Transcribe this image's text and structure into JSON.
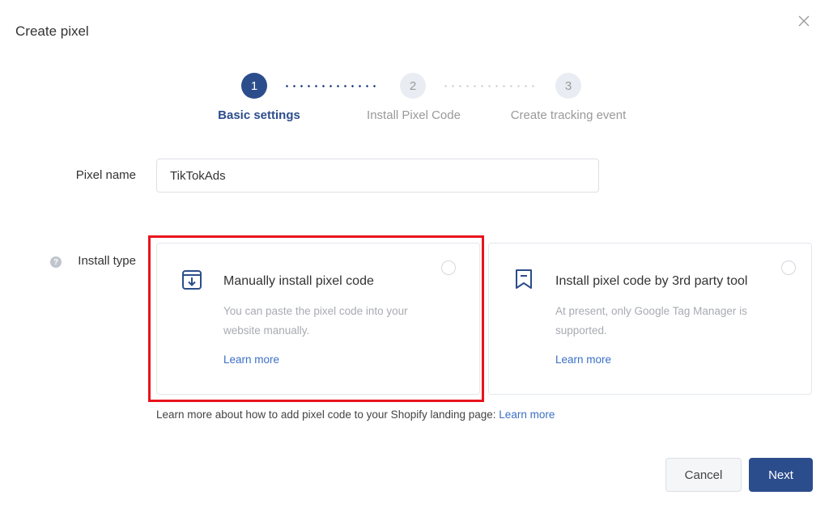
{
  "dialog": {
    "title": "Create pixel",
    "close_icon": "close-icon"
  },
  "stepper": {
    "steps": [
      {
        "number": "1",
        "label": "Basic settings",
        "state": "active"
      },
      {
        "number": "2",
        "label": "Install Pixel Code",
        "state": "inactive"
      },
      {
        "number": "3",
        "label": "Create tracking event",
        "state": "inactive"
      }
    ],
    "colors": {
      "active": "#2c4d8c",
      "inactive": "#e9ecf2"
    }
  },
  "form": {
    "pixel_name": {
      "label": "Pixel name",
      "value": "TikTokAds"
    },
    "install_type": {
      "label": "Install type",
      "help_icon": "question-circle-icon",
      "options": [
        {
          "icon": "download-box-icon",
          "title": "Manually install pixel code",
          "description": "You can paste the pixel code into your website manually.",
          "link": "Learn more",
          "selected": false,
          "highlighted": true
        },
        {
          "icon": "bookmark-icon",
          "title": "Install pixel code by 3rd party tool",
          "description": "At present, only Google Tag Manager is supported.",
          "link": "Learn more",
          "selected": false,
          "highlighted": false
        }
      ]
    },
    "hint": {
      "text": "Learn more about how to add pixel code to your Shopify landing page: ",
      "link": "Learn more"
    }
  },
  "footer": {
    "cancel_label": "Cancel",
    "next_label": "Next"
  },
  "colors": {
    "primary": "#2c4d8c",
    "link": "#3b6fc4",
    "highlight": "#e8141c"
  }
}
